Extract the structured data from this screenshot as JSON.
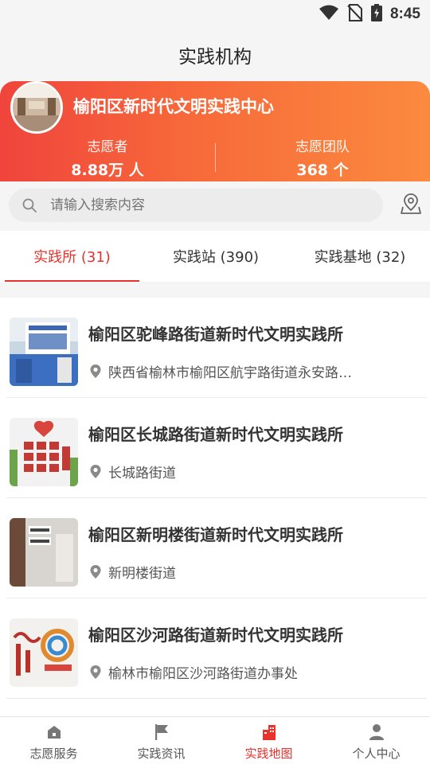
{
  "status_bar": {
    "time": "8:45"
  },
  "header": {
    "title": "实践机构"
  },
  "banner": {
    "org_name": "榆阳区新时代文明实践中心",
    "stats": [
      {
        "label": "志愿者",
        "value": "8.88万 人"
      },
      {
        "label": "志愿团队",
        "value": "368 个"
      }
    ]
  },
  "search": {
    "placeholder": "请输入搜索内容"
  },
  "tabs": [
    {
      "label": "实践所 (31)"
    },
    {
      "label": "实践站 (390)"
    },
    {
      "label": "实践基地 (32)"
    }
  ],
  "list": [
    {
      "title": "榆阳区驼峰路街道新时代文明实践所",
      "address": "陕西省榆林市榆阳区航宇路街道永安路…"
    },
    {
      "title": "榆阳区长城路街道新时代文明实践所",
      "address": "长城路街道"
    },
    {
      "title": "榆阳区新明楼街道新时代文明实践所",
      "address": "新明楼街道"
    },
    {
      "title": "榆阳区沙河路街道新时代文明实践所",
      "address": "榆林市榆阳区沙河路街道办事处"
    }
  ],
  "bottom_nav": [
    {
      "label": "志愿服务",
      "icon": "home-icon"
    },
    {
      "label": "实践资讯",
      "icon": "flag-icon"
    },
    {
      "label": "实践地图",
      "icon": "building-icon"
    },
    {
      "label": "个人中心",
      "icon": "person-icon"
    }
  ],
  "colors": {
    "accent": "#e8322c",
    "banner_start": "#f0443c",
    "banner_end": "#fb8a3e"
  }
}
